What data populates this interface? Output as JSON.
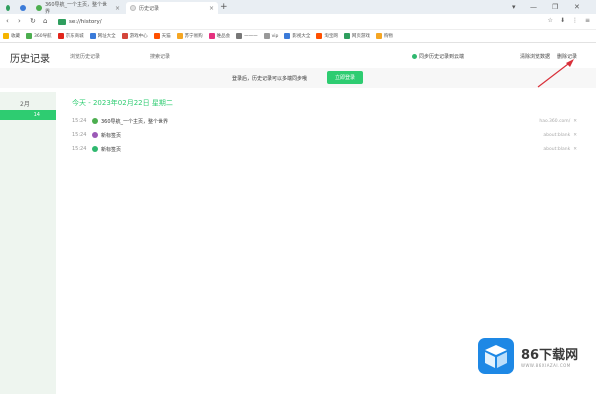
{
  "browser": {
    "tabs": [
      {
        "label": "",
        "color": "#2f9e5e"
      },
      {
        "label": "",
        "color": "#3b7bd9"
      },
      {
        "label": "360导航_一个主页，整个世界",
        "color": "#4cae4f",
        "active": false
      },
      {
        "label": "历史记录",
        "color": "#e0e0e0",
        "active": true
      }
    ],
    "new_tab_label": "+",
    "window_controls": [
      "▾",
      "—",
      "❐",
      "✕"
    ],
    "nav": {
      "back": "‹",
      "forward": "›",
      "reload": "↻",
      "home": "⌂"
    },
    "address": "se://history/",
    "toolbar_icons": [
      "☆",
      "⬇",
      "⋮",
      "≡"
    ]
  },
  "bookmarks": [
    {
      "label": "收藏",
      "color": "#f5b400"
    },
    {
      "label": "360导航",
      "color": "#4cae4f"
    },
    {
      "label": "京东商城",
      "color": "#e1251b"
    },
    {
      "label": "网址大全",
      "color": "#3b7bd9"
    },
    {
      "label": "游戏中心",
      "color": "#d4453a"
    },
    {
      "label": "天猫",
      "color": "#ff5000"
    },
    {
      "label": "苏宁易购",
      "color": "#f5a623"
    },
    {
      "label": "唯品会",
      "color": "#e5317e"
    },
    {
      "label": "一一一",
      "color": "#777777"
    },
    {
      "label": "vip",
      "color": "#999999"
    },
    {
      "label": "影视大全",
      "color": "#3b7bd9"
    },
    {
      "label": "淘宝网",
      "color": "#ff5000"
    },
    {
      "label": "网页游戏",
      "color": "#2f9e5e"
    },
    {
      "label": "购物",
      "color": "#f5a623"
    }
  ],
  "page": {
    "title": "历史记录",
    "tabs": [
      "浏览历史记录",
      "搜索记录"
    ],
    "actions": {
      "sync": "同步历史记录到云端",
      "clear": "清除浏览数据",
      "delete": "删除记录"
    },
    "banner_text": "登录后，历史记录可以多端同步哦",
    "login_label": "立即登录"
  },
  "sidebar": {
    "month": "2月",
    "day": "14"
  },
  "history": {
    "date_heading": "今天 - 2023年02月22日 星期二",
    "entries": [
      {
        "time": "15:24",
        "title": "360导航_一个主页，整个世界",
        "url": "hao.360.com/",
        "icon_color": "#4cae4f"
      },
      {
        "time": "15:24",
        "title": "新标签页",
        "url": "about:blank",
        "icon_color": "#9b59b6"
      },
      {
        "time": "15:24",
        "title": "新标签页",
        "url": "about:blank",
        "icon_color": "#2fb86f"
      }
    ],
    "close_glyph": "✕"
  },
  "watermark": {
    "main": "86下载网",
    "sub": "WWW.86XIAZAI.COM"
  },
  "colors": {
    "accent": "#2ecc71",
    "arrow": "#d9303a"
  }
}
